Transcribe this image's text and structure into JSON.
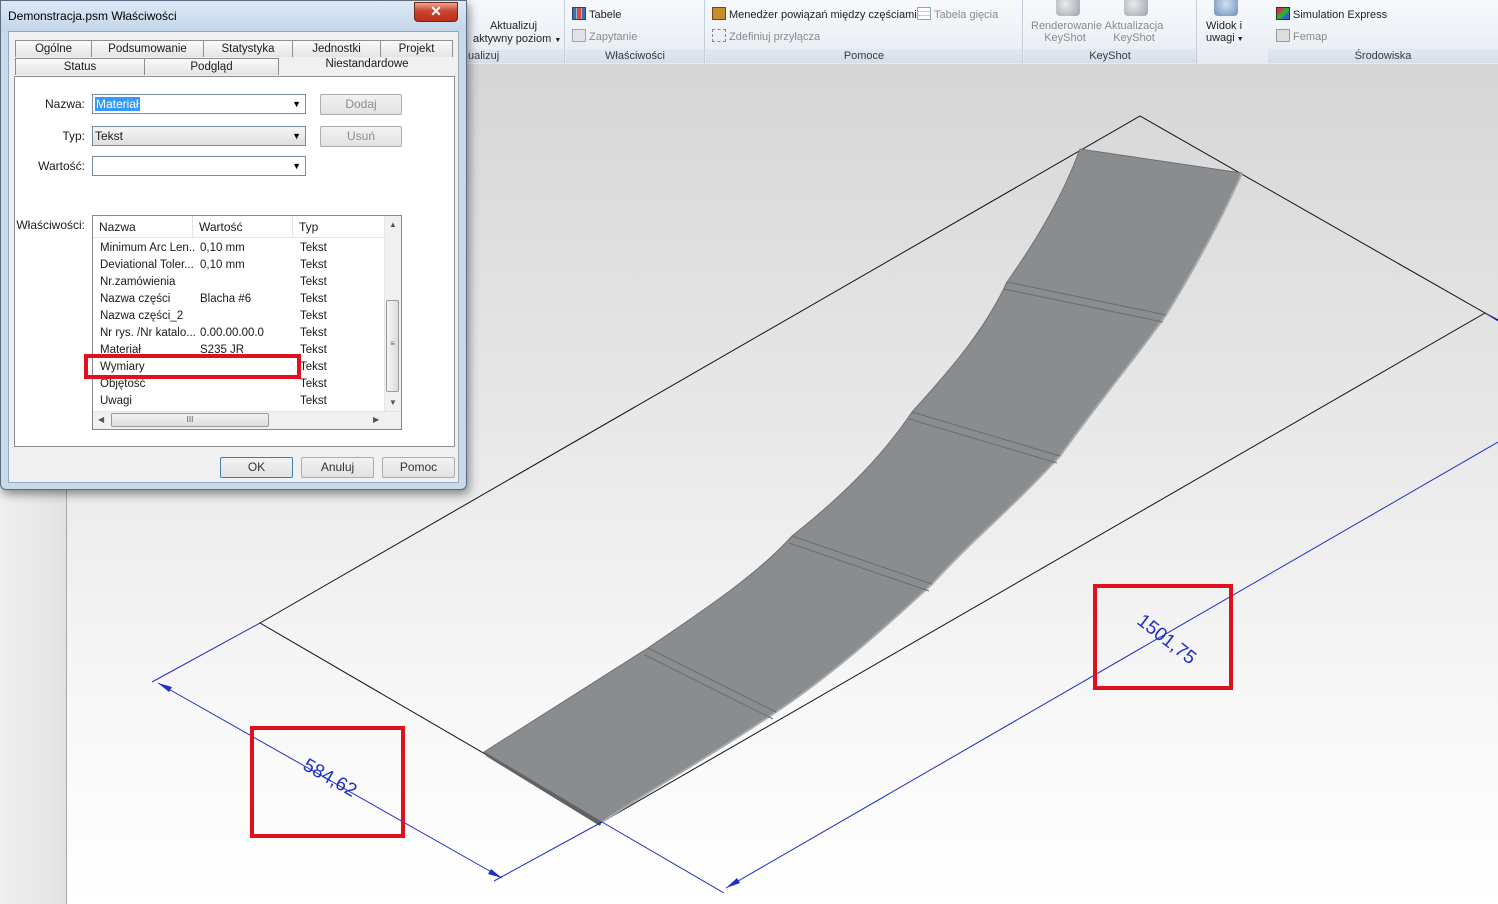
{
  "ribbon": {
    "groups": [
      {
        "id": "update",
        "label": "ualizuj",
        "buttons": [
          {
            "label": "Aktualizuj",
            "disabled": false
          },
          {
            "label": "aktywny poziom",
            "disabled": false
          }
        ]
      },
      {
        "id": "properties",
        "label": "Właściwości",
        "buttons": [
          {
            "label": "Tabele",
            "disabled": false
          },
          {
            "label": "Zapytanie",
            "disabled": true
          }
        ]
      },
      {
        "id": "helpers",
        "label": "Pomoce",
        "buttons": [
          {
            "label": "Menedżer powiązań między częściami",
            "disabled": false
          },
          {
            "label": "Tabela gięcia",
            "disabled": true
          },
          {
            "label": "Zdefiniuj przyłącza",
            "disabled": true
          }
        ]
      },
      {
        "id": "keyshot",
        "label": "KeyShot",
        "buttons": [
          {
            "label": "Renderowanie",
            "line2": "KeyShot",
            "disabled": true
          },
          {
            "label": "Aktualizacja",
            "line2": "KeyShot",
            "disabled": true
          }
        ]
      },
      {
        "id": "view",
        "label": "",
        "buttons": [
          {
            "label": "Widok i",
            "line2": "uwagi"
          }
        ]
      },
      {
        "id": "env",
        "label": "Środowiska",
        "buttons": [
          {
            "label": "Simulation Express",
            "disabled": false
          },
          {
            "label": "Femap",
            "disabled": true
          }
        ]
      }
    ]
  },
  "dialog": {
    "title": "Demonstracja.psm Właściwości",
    "close_glyph": "✕",
    "tabs_row1": [
      "Ogólne",
      "Podsumowanie",
      "Statystyka",
      "Jednostki",
      "Projekt"
    ],
    "tabs_row2": [
      "Status",
      "Podgląd",
      "Niestandardowe"
    ],
    "active_tab": "Niestandardowe",
    "fields": {
      "name_label": "Nazwa:",
      "name_value": "Materiał",
      "type_label": "Typ:",
      "type_value": "Tekst",
      "value_label": "Wartość:",
      "value_value": ""
    },
    "side_buttons": {
      "add": "Dodaj",
      "remove": "Usuń"
    },
    "properties_label": "Właściwości:",
    "columns": [
      "Nazwa",
      "Wartość",
      "Typ"
    ],
    "rows": [
      {
        "name": "Minimum Arc Len...",
        "value": "0,10 mm",
        "type": "Tekst"
      },
      {
        "name": "Deviational Toler...",
        "value": "0,10 mm",
        "type": "Tekst"
      },
      {
        "name": "Nr.zamówienia",
        "value": "",
        "type": "Tekst"
      },
      {
        "name": "Nazwa części",
        "value": "Blacha #6",
        "type": "Tekst"
      },
      {
        "name": "Nazwa części_2",
        "value": "",
        "type": "Tekst"
      },
      {
        "name": "Nr rys. /Nr katalo...",
        "value": "0.00.00.00.0",
        "type": "Tekst"
      },
      {
        "name": "Materiał",
        "value": "S235 JR",
        "type": "Tekst"
      },
      {
        "name": "Wymiary",
        "value": "",
        "type": "Tekst"
      },
      {
        "name": "Objętość",
        "value": "",
        "type": "Tekst"
      },
      {
        "name": "Uwagi",
        "value": "",
        "type": "Tekst"
      }
    ],
    "scroll_grip": "III",
    "footer_buttons": {
      "ok": "OK",
      "cancel": "Anuluj",
      "help": "Pomoc"
    }
  },
  "drawing": {
    "dimension_short": "584,62",
    "dimension_long": "1501,75",
    "dimension_color": "#1f2fc4",
    "part_color": "#8a8d90",
    "highlight_color": "#e0101c"
  }
}
